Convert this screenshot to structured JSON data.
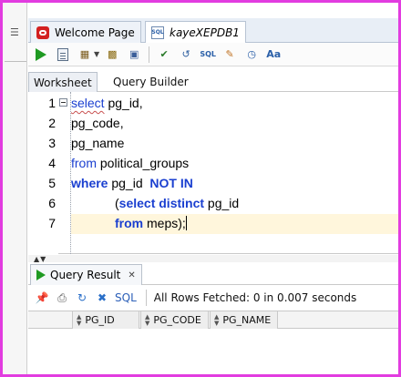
{
  "doc_tabs": [
    {
      "label": "Welcome Page",
      "icon": "oracle-icon",
      "active": false
    },
    {
      "label": "kayeXEPDB1",
      "icon": "sql-worksheet-icon",
      "active": true
    }
  ],
  "sub_tabs": [
    "Worksheet",
    "Query Builder"
  ],
  "editor": {
    "line_numbers": [
      "1",
      "2",
      "3",
      "4",
      "5",
      "6",
      "7"
    ],
    "lines": {
      "l1_kw": "select",
      "l1_rest": " pg_id,",
      "l2": "pg_code,",
      "l3": "pg_name",
      "l4_kw": "from",
      "l4_rest": " political_groups",
      "l5_kw": "where",
      "l5_mid": " pg_id  ",
      "l5_kw2": "NOT IN",
      "l6_open": "(",
      "l6_kw": "select distinct",
      "l6_rest": " pg_id",
      "l7_kw": "from",
      "l7_rest": " meps);"
    }
  },
  "result": {
    "tab_label": "Query Result",
    "sql_label": "SQL",
    "status": "All Rows Fetched: 0 in 0.007 seconds",
    "columns": [
      "PG_ID",
      "PG_CODE",
      "PG_NAME"
    ]
  },
  "colors": {
    "frame": "#e23ce0",
    "keyword": "#1a3fd0",
    "run": "#1f9a22",
    "current_line": "#fff6dc"
  }
}
